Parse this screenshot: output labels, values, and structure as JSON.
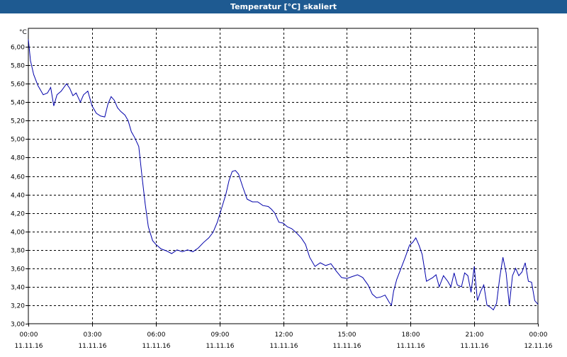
{
  "window": {
    "title": "Temperatur [°C] skaliert"
  },
  "chart_data": {
    "type": "line",
    "title": "Temperatur [°C] skaliert",
    "ylabel": "°C",
    "xlabel": "",
    "ylim": [
      3.0,
      6.2
    ],
    "xlim_hours": [
      0,
      24
    ],
    "yticks": [
      "3,00",
      "3,20",
      "3,40",
      "3,60",
      "3,80",
      "4,00",
      "4,20",
      "4,40",
      "4,60",
      "4,80",
      "5,00",
      "5,20",
      "5,40",
      "5,60",
      "5,80",
      "6,00"
    ],
    "xticks": [
      {
        "time": "00:00",
        "date": "11.11.16"
      },
      {
        "time": "03:00",
        "date": "11.11.16"
      },
      {
        "time": "06:00",
        "date": "11.11.16"
      },
      {
        "time": "09:00",
        "date": "11.11.16"
      },
      {
        "time": "12:00",
        "date": "11.11.16"
      },
      {
        "time": "15:00",
        "date": "11.11.16"
      },
      {
        "time": "18:00",
        "date": "11.11.16"
      },
      {
        "time": "21:00",
        "date": "11.11.16"
      },
      {
        "time": "00:00",
        "date": "12.11.16"
      }
    ],
    "grid": true,
    "line_color": "#0000aa",
    "series": [
      {
        "x": [
          0.0,
          0.1,
          0.25,
          0.45,
          0.7,
          0.9,
          1.05,
          1.2,
          1.35,
          1.55,
          1.8,
          1.95,
          2.1,
          2.25,
          2.45,
          2.6,
          2.8,
          3.0,
          3.2,
          3.4,
          3.6,
          3.75,
          3.9,
          4.05,
          4.2,
          4.35,
          4.55,
          4.7,
          4.85,
          5.0,
          5.2,
          5.35,
          5.5,
          5.65,
          5.85,
          6.0,
          6.25,
          6.5,
          6.75,
          7.0,
          7.25,
          7.5,
          7.75,
          8.0,
          8.25,
          8.5,
          8.7,
          8.9,
          9.1,
          9.3,
          9.45,
          9.6,
          9.75,
          9.9,
          10.1,
          10.3,
          10.55,
          10.8,
          11.05,
          11.3,
          11.45,
          11.6,
          11.8,
          12.0,
          12.2,
          12.4,
          12.6,
          12.85,
          13.05,
          13.25,
          13.5,
          13.75,
          14.0,
          14.25,
          14.5,
          14.75,
          15.0,
          15.25,
          15.5,
          15.75,
          16.0,
          16.2,
          16.4,
          16.6,
          16.8,
          17.0,
          17.1,
          17.2,
          17.35,
          17.55,
          17.75,
          17.95,
          18.1,
          18.25,
          18.4,
          18.55,
          18.75,
          18.9,
          19.05,
          19.2,
          19.35,
          19.55,
          19.75,
          19.9,
          20.05,
          20.2,
          20.4,
          20.55,
          20.7,
          20.85,
          21.0,
          21.15,
          21.3,
          21.45,
          21.6,
          21.75,
          21.9,
          22.05,
          22.2,
          22.35,
          22.5,
          22.65,
          22.8,
          22.95,
          23.1,
          23.25,
          23.4,
          23.55,
          23.7,
          23.85,
          24.0
        ],
        "y": [
          6.08,
          5.85,
          5.7,
          5.58,
          5.48,
          5.5,
          5.56,
          5.36,
          5.48,
          5.52,
          5.6,
          5.55,
          5.47,
          5.5,
          5.4,
          5.48,
          5.52,
          5.36,
          5.28,
          5.25,
          5.24,
          5.38,
          5.46,
          5.42,
          5.34,
          5.3,
          5.26,
          5.2,
          5.08,
          5.02,
          4.92,
          4.6,
          4.3,
          4.05,
          3.9,
          3.86,
          3.81,
          3.79,
          3.76,
          3.8,
          3.78,
          3.8,
          3.78,
          3.82,
          3.88,
          3.93,
          3.99,
          4.1,
          4.25,
          4.4,
          4.55,
          4.65,
          4.66,
          4.62,
          4.48,
          4.35,
          4.32,
          4.32,
          4.28,
          4.27,
          4.24,
          4.2,
          4.1,
          4.09,
          4.05,
          4.03,
          3.99,
          3.93,
          3.86,
          3.72,
          3.62,
          3.66,
          3.63,
          3.65,
          3.57,
          3.5,
          3.49,
          3.51,
          3.53,
          3.5,
          3.42,
          3.32,
          3.28,
          3.29,
          3.31,
          3.23,
          3.2,
          3.35,
          3.48,
          3.6,
          3.72,
          3.85,
          3.88,
          3.93,
          3.85,
          3.75,
          3.46,
          3.48,
          3.5,
          3.53,
          3.4,
          3.52,
          3.46,
          3.4,
          3.55,
          3.42,
          3.4,
          3.55,
          3.52,
          3.34,
          3.62,
          3.25,
          3.35,
          3.42,
          3.2,
          3.18,
          3.15,
          3.22,
          3.5,
          3.72,
          3.55,
          3.2,
          3.52,
          3.6,
          3.52,
          3.56,
          3.66,
          3.46,
          3.45,
          3.25,
          3.21
        ]
      }
    ]
  }
}
